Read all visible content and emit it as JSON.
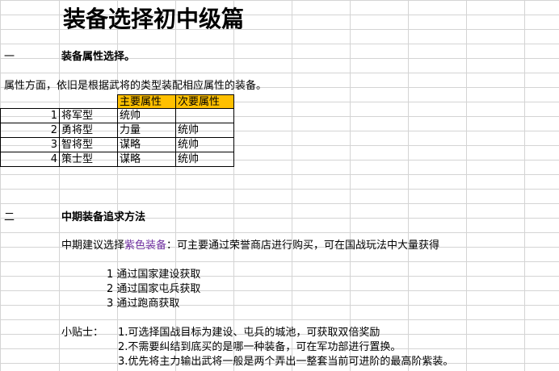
{
  "title": "装备选择初中级篇",
  "section1": {
    "number": "一",
    "heading": "装备属性选择。",
    "intro": "属性方面，依旧是根据武将的类型装配相应属性的装备。"
  },
  "table": {
    "headers": [
      "主要属性",
      "次要属性"
    ],
    "rows": [
      {
        "index": "1",
        "type": "将军型",
        "primary": "统帅",
        "secondary": ""
      },
      {
        "index": "2",
        "type": "勇将型",
        "primary": "力量",
        "secondary": "统帅"
      },
      {
        "index": "3",
        "type": "智将型",
        "primary": "谋略",
        "secondary": "统帅"
      },
      {
        "index": "4",
        "type": "策士型",
        "primary": "谋略",
        "secondary": "统帅"
      }
    ]
  },
  "section2": {
    "number": "二",
    "heading": "中期装备追求方法",
    "suggestion_prefix": "中期建议选择",
    "suggestion_highlight": "紫色装备",
    "suggestion_suffix": "：可主要通过荣誉商店进行购买，可在国战玩法中大量获得",
    "methods": [
      {
        "index": "1",
        "text": "通过国家建设获取"
      },
      {
        "index": "2",
        "text": "通过国家屯兵获取"
      },
      {
        "index": "3",
        "text": "通过跑商获取"
      }
    ],
    "tips_label": "小贴士：",
    "tips": [
      "1.可选择国战目标为建设、屯兵的城池，可获取双倍奖励",
      "2.不需要纠结到底买的是哪一种装备，可在军功部进行置换。",
      "3.优先将主力输出武将一般是两个弄出一整套当前可进阶的最高阶紫装。"
    ]
  },
  "colors": {
    "header_fill": "#ffc000",
    "highlight_text": "#7030a0",
    "gridline": "#d4d4d4"
  }
}
